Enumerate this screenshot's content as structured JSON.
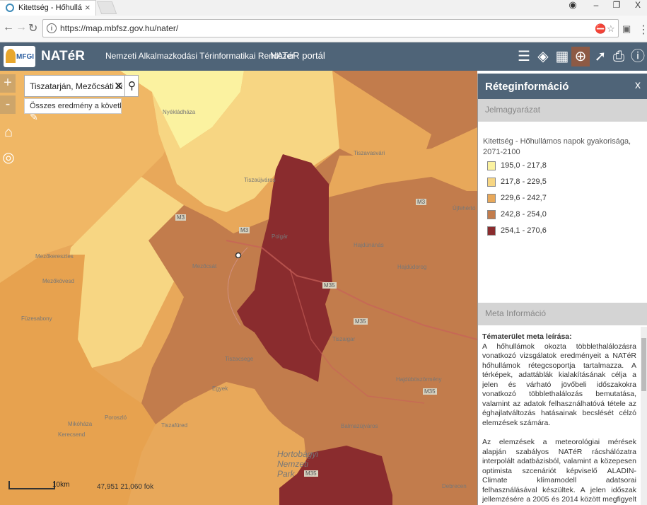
{
  "browser": {
    "tab_title": "Kitettség - Hőhullámos n",
    "url": "https://map.mbfsz.gov.hu/nater/",
    "close_glyph": "×",
    "controls": {
      "minimize": "–",
      "restore": "❐",
      "close": "X"
    }
  },
  "app": {
    "logo_text": "MFGI",
    "title": "NATéR",
    "subtitle": "Nemzeti Alkalmazkodási Térinformatikai Rendszer",
    "portal_link": "NATéR portál",
    "toolbar_icons": [
      "list-icon",
      "layers-icon",
      "grid-icon",
      "globe-icon",
      "pin-icon",
      "print-icon",
      "info-icon"
    ]
  },
  "search": {
    "value": "Tiszatarján, Mezőcsáti Járás",
    "clear_glyph": "✕",
    "more_results": "Összes eredmény a következő..."
  },
  "map": {
    "zoom_in": "+",
    "zoom_out": "-",
    "scale_label": "10km",
    "coords": "47,951  21,060 fok",
    "place_names": [
      "Nyékládháza",
      "Tiszaújváros",
      "Tiszavasvári",
      "Mezőkeresztes",
      "Mezőkövesd",
      "Mezőcsát",
      "Polgár",
      "Hajdúnánás",
      "Hajdúdorog",
      "Füzesabony",
      "Tiszacsege",
      "Hajdúböszörmény",
      "Poroszló",
      "Tiszafüred",
      "Balmazújváros",
      "Hortobágyi Nemzeti Park",
      "Debrecen",
      "Újfehértó",
      "Kerecsend",
      "Mikóháza",
      "Tiszaigar",
      "Egyek"
    ],
    "road_labels": [
      "M3",
      "M3",
      "M35",
      "M35",
      "M35",
      "M3",
      "M35"
    ]
  },
  "panel": {
    "title": "Réteginformáció",
    "close_glyph": "x",
    "legend_header": "Jelmagyarázat",
    "legend_title": "Kitettség - Hőhullámos napok gyakorisága, 2071-2100",
    "legend_items": [
      {
        "label": "195,0 - 217,8",
        "color": "#fbf2a0"
      },
      {
        "label": "217,8 - 229,5",
        "color": "#f7d683"
      },
      {
        "label": "229,6 - 242,7",
        "color": "#e8a85a"
      },
      {
        "label": "242,8 - 254,0",
        "color": "#c27c4c"
      },
      {
        "label": "254,1 - 270,6",
        "color": "#8a2c2e"
      }
    ],
    "meta_header": "Meta Információ",
    "meta_heading": "Tématerület meta leírása:",
    "meta_p1": "A hőhullámok okozta többlethalálozásra vonatkozó vizsgálatok eredményeit a NATéR hőhullámok rétegcsoportja tartalmazza. A térképek, adattáblák kialakításának célja a jelen és várható jövőbeli időszakokra vonatkozó többlethalálozás bemutatása, valamint az adatok felhasználhatóvá tétele az éghajlatváltozás hatásainak becslését célzó elemzések számára.",
    "meta_p2": "Az elemzések a meteorológiai mérések alapján szabályos NATéR rácshálózatra interpolált adatbázisból, valamint a közepesen optimista szcenáriót képviselő ALADIN-Climate klímamodell adatsorai felhasználásával készültek. A jelen időszak jellemzésére a 2005 és 2014 között megfigyelt napi átlaghőmérsékleti adatokat használtuk."
  }
}
